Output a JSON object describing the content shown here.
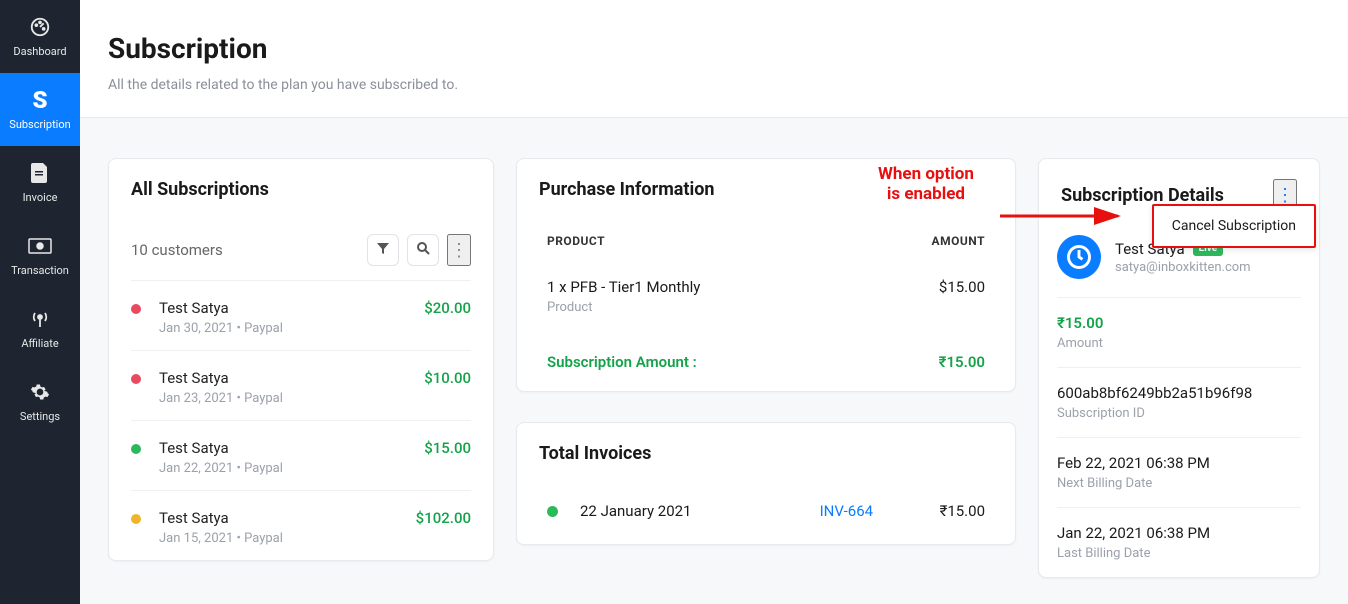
{
  "sidebar": {
    "items": [
      {
        "label": "Dashboard"
      },
      {
        "label": "Subscription"
      },
      {
        "label": "Invoice"
      },
      {
        "label": "Transaction"
      },
      {
        "label": "Affiliate"
      },
      {
        "label": "Settings"
      }
    ]
  },
  "header": {
    "title": "Subscription",
    "subtitle": "All the details related to the plan you have subscribed to."
  },
  "allSubs": {
    "title": "All Subscriptions",
    "countText": "10 customers",
    "rows": [
      {
        "name": "Test Satya",
        "meta": "Jan 30, 2021   • Paypal",
        "amount": "$20.00",
        "color": "#e84a5f"
      },
      {
        "name": "Test Satya",
        "meta": "Jan 23, 2021   • Paypal",
        "amount": "$10.00",
        "color": "#e84a5f"
      },
      {
        "name": "Test Satya",
        "meta": "Jan 22, 2021   • Paypal",
        "amount": "$15.00",
        "color": "#2eb85c"
      },
      {
        "name": "Test Satya",
        "meta": "Jan 15, 2021   • Paypal",
        "amount": "$102.00",
        "color": "#f0b429"
      }
    ]
  },
  "purchase": {
    "title": "Purchase Information",
    "headProduct": "PRODUCT",
    "headAmount": "AMOUNT",
    "item": "1 x PFB - Tier1 Monthly",
    "itemSub": "Product",
    "itemAmount": "$15.00",
    "totalLabel": "Subscription Amount :",
    "totalAmount": "₹15.00"
  },
  "invoices": {
    "title": "Total Invoices",
    "row": {
      "date": "22 January 2021",
      "inv": "INV-664",
      "amt": "₹15.00"
    }
  },
  "details": {
    "title": "Subscription Details",
    "userName": "Test Satya",
    "badge": "Live",
    "email": "satya@inboxkitten.com",
    "blocks": [
      {
        "val": "₹15.00",
        "label": "Amount",
        "accent": true
      },
      {
        "val": "600ab8bf6249bb2a51b96f98",
        "label": "Subscription ID"
      },
      {
        "val": "Feb 22, 2021 06:38 PM",
        "label": "Next Billing Date"
      },
      {
        "val": "Jan 22, 2021 06:38 PM",
        "label": "Last Billing Date"
      }
    ],
    "menuItem": "Cancel Subscription"
  },
  "annotation": {
    "text": "When option\nis enabled"
  }
}
